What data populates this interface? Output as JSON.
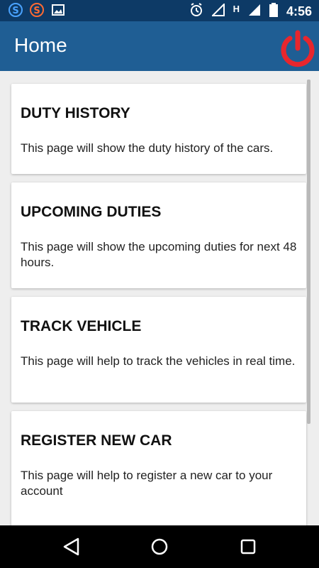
{
  "status_bar": {
    "time": "4:56",
    "network_label": "H",
    "icons": [
      "s-icon",
      "s-orange-icon",
      "image-icon",
      "alarm-icon",
      "signal-icon",
      "network-h-icon",
      "signal-icon",
      "battery-icon"
    ]
  },
  "app_bar": {
    "title": "Home",
    "power_icon_color": "#e8262d",
    "background": "#1f5e94"
  },
  "cards": [
    {
      "title": "DUTY HISTORY",
      "description": "This page will show the duty history of the cars."
    },
    {
      "title": "UPCOMING DUTIES",
      "description": "This page will show the upcoming duties for next 48 hours."
    },
    {
      "title": "TRACK VEHICLE",
      "description": "This page will help to track the vehicles in real time."
    },
    {
      "title": "REGISTER NEW CAR",
      "description": "This page will help to register a new car to your account"
    }
  ],
  "nav_bar": {
    "icons": [
      "back-icon",
      "home-icon",
      "recents-icon"
    ]
  }
}
